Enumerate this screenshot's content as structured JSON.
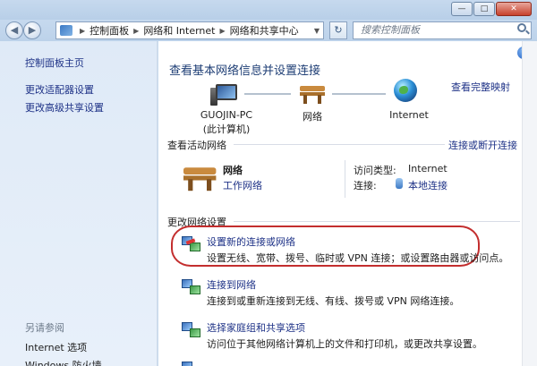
{
  "window": {
    "minimize_glyph": "—",
    "maximize_glyph": "□",
    "close_glyph": "✕"
  },
  "nav": {
    "back_glyph": "◀",
    "forward_glyph": "▶",
    "breadcrumb": [
      "控制面板",
      "网络和 Internet",
      "网络和共享中心"
    ],
    "refresh_glyph": "↻",
    "search_placeholder": "搜索控制面板"
  },
  "sidebar": {
    "home": "控制面板主页",
    "items": [
      "更改适配器设置",
      "更改高级共享设置"
    ],
    "see_also_header": "另请参阅",
    "see_also": [
      "Internet 选项",
      "Windows 防火墙"
    ]
  },
  "main": {
    "help_glyph": "?",
    "heading": "查看基本网络信息并设置连接",
    "view_full_map": "查看完整映射",
    "map": {
      "computer_name": "GUOJIN-PC",
      "computer_sub": "(此计算机)",
      "network": "网络",
      "internet": "Internet"
    },
    "active_header": "查看活动网络",
    "connect_disconnect": "连接或断开连接",
    "active": {
      "name": "网络",
      "type_link": "工作网络",
      "access_label": "访问类型:",
      "access_value": "Internet",
      "conn_label": "连接:",
      "conn_value": "本地连接"
    },
    "change_header": "更改网络设置",
    "tasks": [
      {
        "title": "设置新的连接或网络",
        "desc": "设置无线、宽带、拨号、临时或 VPN 连接；或设置路由器或访问点。"
      },
      {
        "title": "连接到网络",
        "desc": "连接到或重新连接到无线、有线、拨号或 VPN 网络连接。"
      },
      {
        "title": "选择家庭组和共享选项",
        "desc": "访问位于其他网络计算机上的文件和打印机，或更改共享设置。"
      }
    ]
  },
  "colors": {
    "link": "#1e3287",
    "heading": "#1e3e75",
    "highlight_ring": "#c32e2e"
  }
}
